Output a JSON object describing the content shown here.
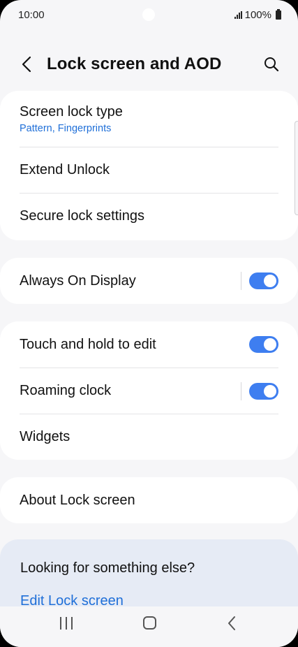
{
  "status_bar": {
    "time": "10:00",
    "battery": "100%",
    "icons": [
      "signal-icon",
      "battery-icon"
    ]
  },
  "header": {
    "title": "Lock screen and AOD",
    "back_icon": "chevron-left-icon",
    "search_icon": "search-icon"
  },
  "lock_card": {
    "items": [
      {
        "label": "Screen lock type",
        "sub": "Pattern, Fingerprints"
      },
      {
        "label": "Extend Unlock"
      },
      {
        "label": "Secure lock settings"
      }
    ]
  },
  "aod_card": {
    "label": "Always On Display",
    "toggle_on": true
  },
  "edit_card": {
    "items": [
      {
        "label": "Touch and hold to edit",
        "toggle_on": true
      },
      {
        "label": "Roaming clock",
        "toggle_on": true
      },
      {
        "label": "Widgets"
      }
    ]
  },
  "about_card": {
    "label": "About Lock screen"
  },
  "help": {
    "title": "Looking for something else?",
    "link": "Edit Lock screen"
  },
  "nav_bar": {
    "icons": [
      "recents-icon",
      "home-icon",
      "back-icon"
    ]
  },
  "colors": {
    "accent": "#3e7ef0",
    "link": "#1f6fd8",
    "background": "#f6f6f8",
    "card": "#ffffff",
    "help_card": "#e6ebf5"
  }
}
